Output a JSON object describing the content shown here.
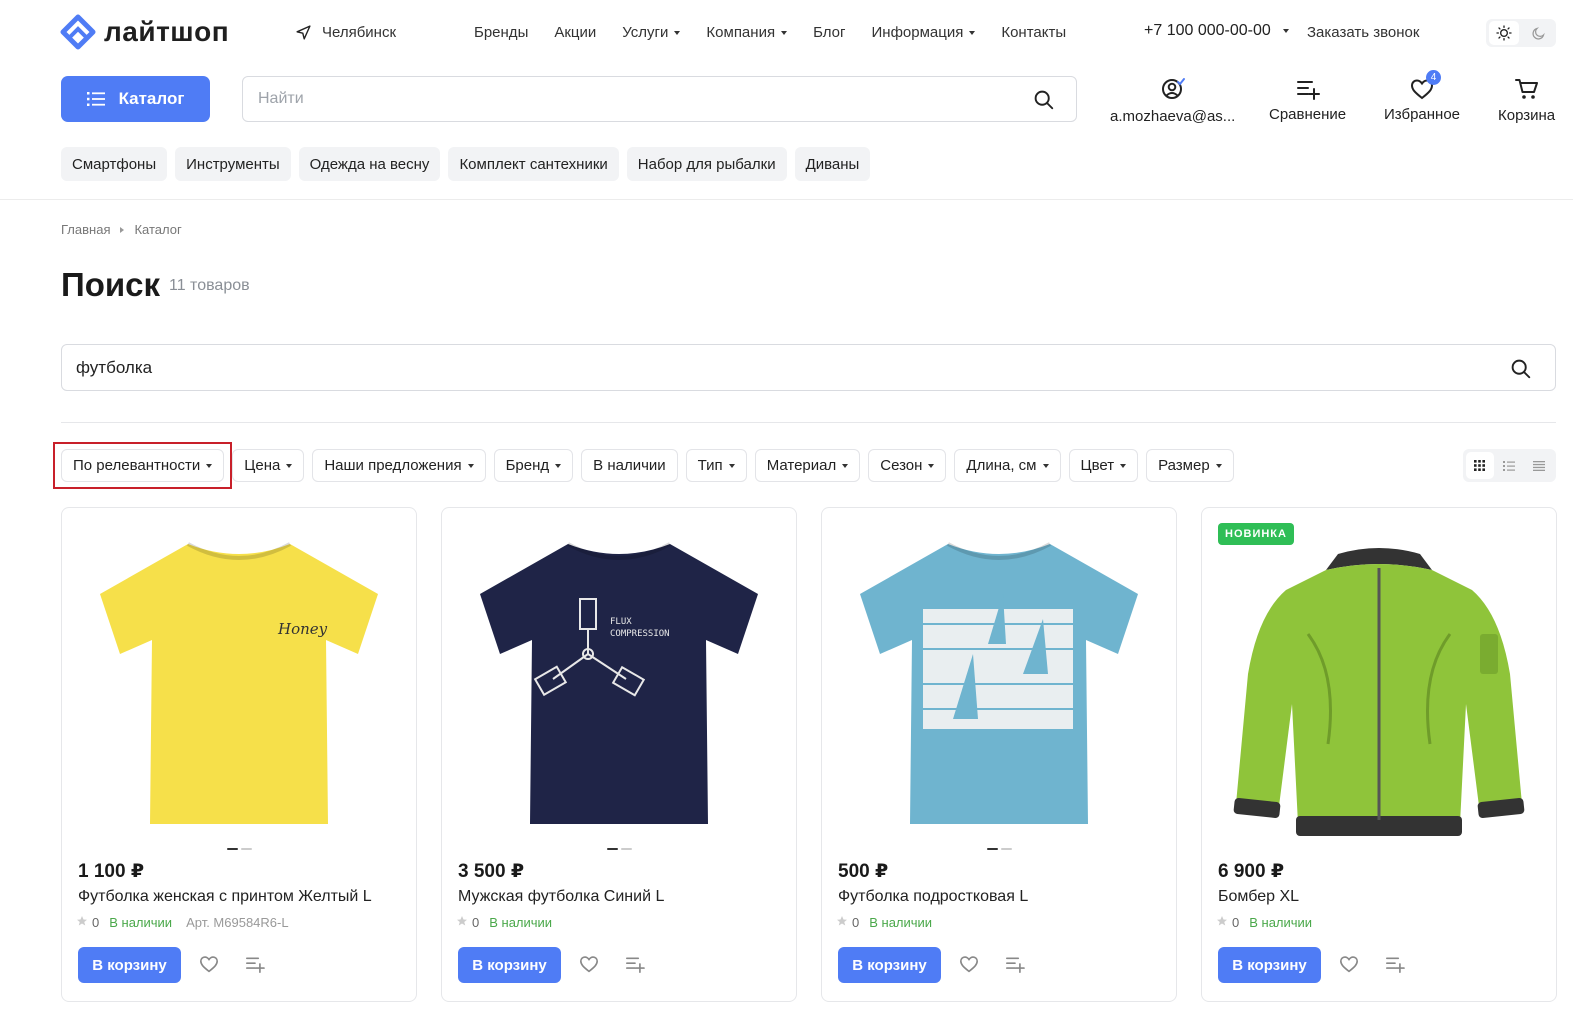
{
  "header": {
    "logo_text": "лайтшоп",
    "city": "Челябинск",
    "nav": [
      {
        "label": "Бренды",
        "has_caret": false
      },
      {
        "label": "Акции",
        "has_caret": false
      },
      {
        "label": "Услуги",
        "has_caret": true
      },
      {
        "label": "Компания",
        "has_caret": true
      },
      {
        "label": "Блог",
        "has_caret": false
      },
      {
        "label": "Информация",
        "has_caret": true
      },
      {
        "label": "Контакты",
        "has_caret": false
      }
    ],
    "phone": "+7 100 000-00-00",
    "callback": "Заказать звонок",
    "catalog_label": "Каталог",
    "search_placeholder": "Найти",
    "account_label": "a.mozhaeva@as...",
    "compare_label": "Сравнение",
    "favorites_label": "Избранное",
    "favorites_count": "4",
    "cart_label": "Корзина",
    "quick_tags": [
      "Смартфоны",
      "Инструменты",
      "Одежда на весну",
      "Комплект сантехники",
      "Набор для рыбалки",
      "Диваны"
    ]
  },
  "breadcrumb": [
    "Главная",
    "Каталог"
  ],
  "page": {
    "title": "Поиск",
    "count": "11 товаров",
    "search_value": "футболка"
  },
  "filters": {
    "sort": "По релевантности",
    "chips": [
      {
        "label": "Цена",
        "has_caret": true
      },
      {
        "label": "Наши предложения",
        "has_caret": true
      },
      {
        "label": "Бренд",
        "has_caret": true
      },
      {
        "label": "В наличии",
        "has_caret": false
      },
      {
        "label": "Тип",
        "has_caret": true
      },
      {
        "label": "Материал",
        "has_caret": true
      },
      {
        "label": "Сезон",
        "has_caret": true
      },
      {
        "label": "Длина, см",
        "has_caret": true
      },
      {
        "label": "Цвет",
        "has_caret": true
      },
      {
        "label": "Размер",
        "has_caret": true
      }
    ]
  },
  "products": [
    {
      "price": "1 100 ₽",
      "name": "Футболка женская с принтом Желтый L",
      "rating": "0",
      "stock": "В наличии",
      "article": "Арт. M69584R6-L",
      "buy": "В корзину",
      "badge": "",
      "image": "yellow-tshirt",
      "color": "#f6e04a"
    },
    {
      "price": "3 500 ₽",
      "name": "Мужская футболка Синий L",
      "rating": "0",
      "stock": "В наличии",
      "article": "",
      "buy": "В корзину",
      "badge": "",
      "image": "navy-tshirt",
      "color": "#1f2447"
    },
    {
      "price": "500 ₽",
      "name": "Футболка подростковая L",
      "rating": "0",
      "stock": "В наличии",
      "article": "",
      "buy": "В корзину",
      "badge": "",
      "image": "blue-tshirt",
      "color": "#6fb4cf"
    },
    {
      "price": "6 900 ₽",
      "name": "Бомбер XL",
      "rating": "0",
      "stock": "В наличии",
      "article": "",
      "buy": "В корзину",
      "badge": "НОВИНКА",
      "image": "green-bomber",
      "color": "#8fc43a"
    }
  ],
  "colors": {
    "accent": "#4f7cf5",
    "in_stock": "#4aa84a",
    "new_badge": "#2fbe56",
    "highlight": "#c8202a"
  }
}
